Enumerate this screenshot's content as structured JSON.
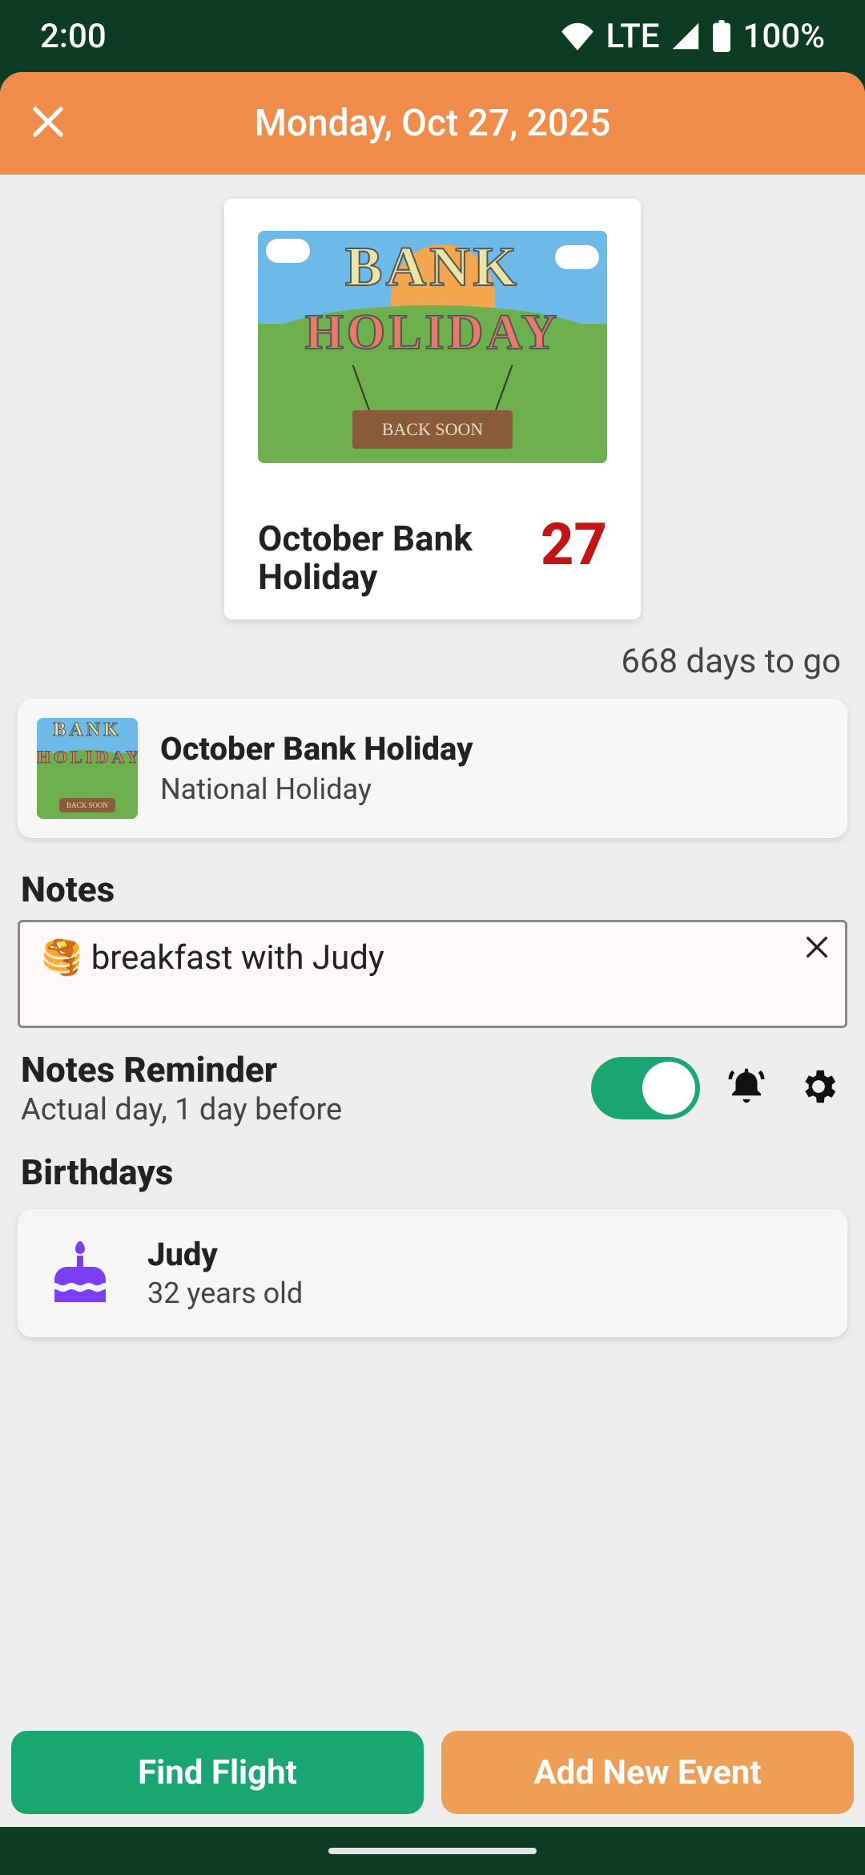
{
  "status": {
    "time": "2:00",
    "network": "LTE",
    "battery": "100%"
  },
  "header": {
    "date_title": "Monday, Oct 27, 2025"
  },
  "featured": {
    "image_text_top": "BANK",
    "image_text_bottom": "HOLIDAY",
    "image_sign": "BACK SOON",
    "title": "October Bank Holiday",
    "day_number": "27"
  },
  "countdown": "668 days to go",
  "event": {
    "title": "October Bank Holiday",
    "subtitle": "National Holiday"
  },
  "sections": {
    "notes": "Notes",
    "notes_reminder": "Notes Reminder",
    "birthdays": "Birthdays"
  },
  "notes": {
    "text": "🥞 breakfast with Judy"
  },
  "reminder": {
    "subtitle": "Actual day, 1 day before",
    "enabled": true
  },
  "birthday": {
    "name": "Judy",
    "age": "32 years old"
  },
  "buttons": {
    "find_flight": "Find Flight",
    "add_event": "Add New Event"
  },
  "colors": {
    "accent_orange": "#f08c4a",
    "accent_green": "#1aa672",
    "danger_red": "#c21616",
    "cake_purple": "#7b3ff2"
  }
}
